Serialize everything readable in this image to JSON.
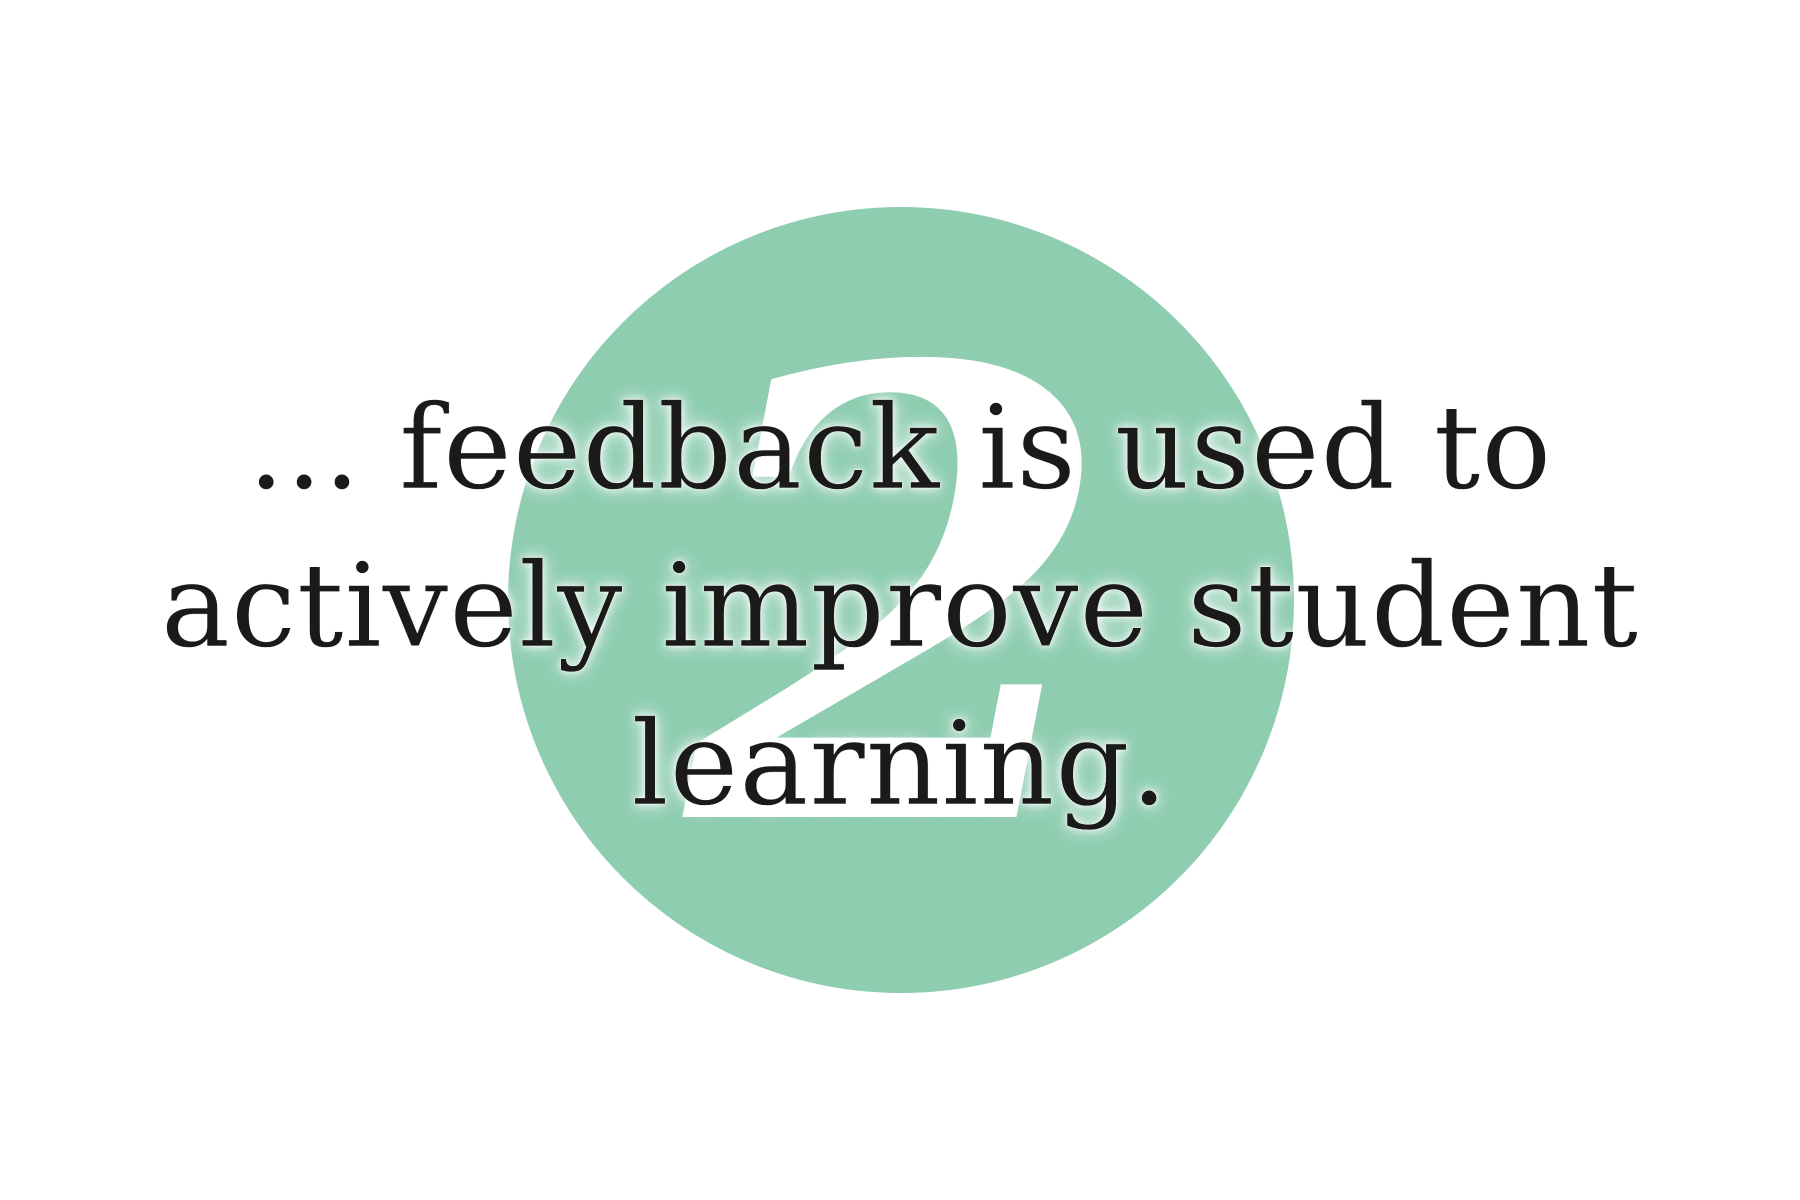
{
  "badge": {
    "numeral": "2",
    "color": "#8ecdb0"
  },
  "statement": {
    "line1": "... feedback is used to",
    "line2": "actively improve student",
    "line3": "learning."
  }
}
